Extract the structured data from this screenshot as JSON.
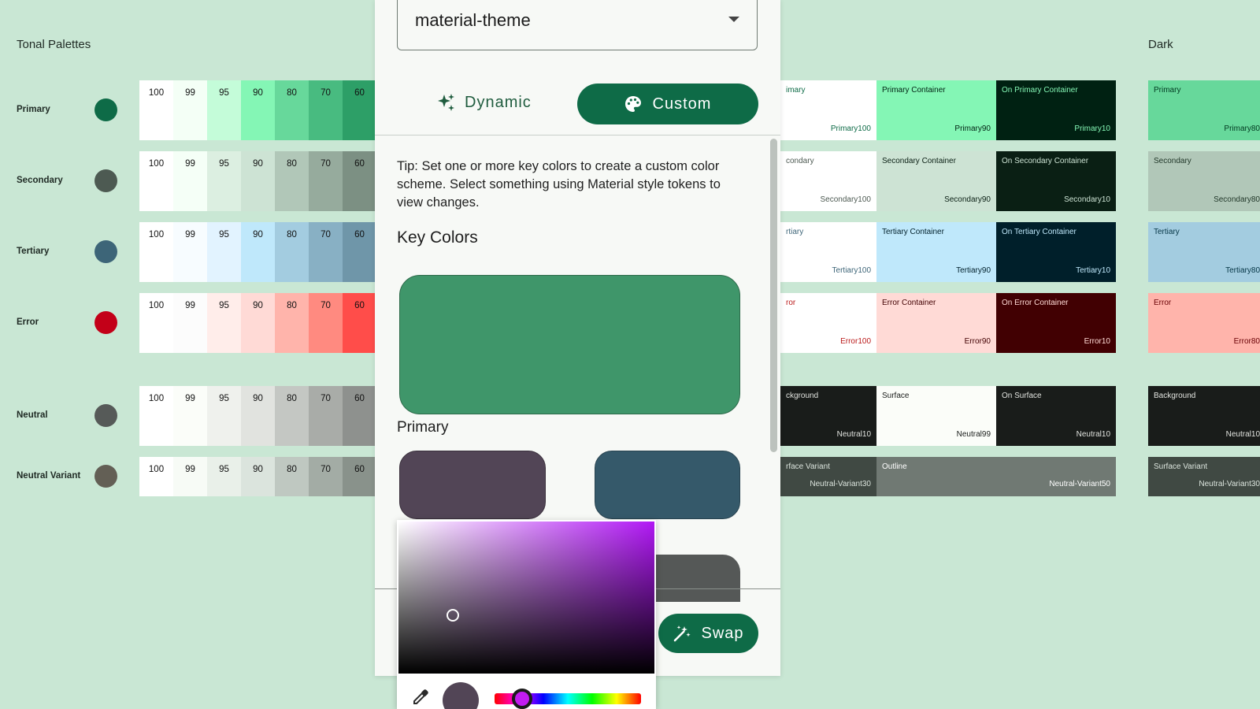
{
  "tonal": {
    "title": "Tonal Palettes",
    "rows": [
      {
        "name": "Primary",
        "dot": "#0e6b47",
        "tones": [
          {
            "label": "100",
            "color": "#ffffff"
          },
          {
            "label": "99",
            "color": "#f4fff6"
          },
          {
            "label": "95",
            "color": "#c4fcd9"
          },
          {
            "label": "90",
            "color": "#84f6b5"
          },
          {
            "label": "80",
            "color": "#67d89b"
          },
          {
            "label": "70",
            "color": "#48bb80"
          },
          {
            "label": "60",
            "color": "#2d9f67"
          }
        ]
      },
      {
        "name": "Secondary",
        "dot": "#4d5a52",
        "tones": [
          {
            "label": "100",
            "color": "#ffffff"
          },
          {
            "label": "99",
            "color": "#f5fff7"
          },
          {
            "label": "95",
            "color": "#dcefe1"
          },
          {
            "label": "90",
            "color": "#cde3d4"
          },
          {
            "label": "80",
            "color": "#b1c7b8"
          },
          {
            "label": "70",
            "color": "#96ab9d"
          },
          {
            "label": "60",
            "color": "#7c9083"
          }
        ]
      },
      {
        "name": "Tertiary",
        "dot": "#3d6578",
        "tones": [
          {
            "label": "100",
            "color": "#ffffff"
          },
          {
            "label": "99",
            "color": "#f7fcff"
          },
          {
            "label": "95",
            "color": "#e2f3ff"
          },
          {
            "label": "90",
            "color": "#bfe8fb"
          },
          {
            "label": "80",
            "color": "#a3cce0"
          },
          {
            "label": "70",
            "color": "#88b0c4"
          },
          {
            "label": "60",
            "color": "#6f96a9"
          }
        ]
      },
      {
        "name": "Error",
        "dot": "#c30018",
        "tones": [
          {
            "label": "100",
            "color": "#ffffff"
          },
          {
            "label": "99",
            "color": "#fcfcfc"
          },
          {
            "label": "95",
            "color": "#ffedea"
          },
          {
            "label": "90",
            "color": "#ffdad6"
          },
          {
            "label": "80",
            "color": "#ffb4ab"
          },
          {
            "label": "70",
            "color": "#ff8a80"
          },
          {
            "label": "60",
            "color": "#ff4d4a"
          }
        ]
      },
      {
        "name": "Neutral",
        "dot": "#565a58",
        "tones": [
          {
            "label": "100",
            "color": "#ffffff"
          },
          {
            "label": "99",
            "color": "#fbfdf9"
          },
          {
            "label": "95",
            "color": "#eff1ed"
          },
          {
            "label": "90",
            "color": "#e1e3df"
          },
          {
            "label": "80",
            "color": "#c4c7c3"
          },
          {
            "label": "70",
            "color": "#a9aca8"
          },
          {
            "label": "60",
            "color": "#8e918e"
          }
        ]
      },
      {
        "name": "Neutral Variant",
        "dot": "#635f55",
        "tones": [
          {
            "label": "100",
            "color": "#ffffff"
          },
          {
            "label": "99",
            "color": "#f7fbf6"
          },
          {
            "label": "95",
            "color": "#e9f0e9"
          },
          {
            "label": "90",
            "color": "#dbe4dd"
          },
          {
            "label": "80",
            "color": "#bfc8c1"
          },
          {
            "label": "70",
            "color": "#a3aca5"
          },
          {
            "label": "60",
            "color": "#89928b"
          }
        ]
      }
    ]
  },
  "scheme": {
    "tiles": [
      {
        "name": "imary",
        "tone": "Primary100",
        "bg": "#ffffff",
        "fg": "#0e6b47"
      },
      {
        "name": "Primary Container",
        "tone": "Primary90",
        "bg": "#84f6b5",
        "fg": "#002112"
      },
      {
        "name": "On Primary Container",
        "tone": "Primary10",
        "bg": "#002112",
        "fg": "#84f6b5"
      },
      {
        "name": "condary",
        "tone": "Secondary100",
        "bg": "#ffffff",
        "fg": "#4d5a52"
      },
      {
        "name": "Secondary Container",
        "tone": "Secondary90",
        "bg": "#cde3d4",
        "fg": "#0a1f14"
      },
      {
        "name": "On Secondary Container",
        "tone": "Secondary10",
        "bg": "#0a1f14",
        "fg": "#cde3d4"
      },
      {
        "name": "rtiary",
        "tone": "Tertiary100",
        "bg": "#ffffff",
        "fg": "#3d6578"
      },
      {
        "name": "Tertiary Container",
        "tone": "Tertiary90",
        "bg": "#bfe8fb",
        "fg": "#001f2a"
      },
      {
        "name": "On Tertiary Container",
        "tone": "Tertiary10",
        "bg": "#001f2a",
        "fg": "#bfe8fb"
      },
      {
        "name": "ror",
        "tone": "Error100",
        "bg": "#ffffff",
        "fg": "#ba1a1a"
      },
      {
        "name": "Error Container",
        "tone": "Error90",
        "bg": "#ffdad6",
        "fg": "#410002"
      },
      {
        "name": "On Error Container",
        "tone": "Error10",
        "bg": "#410002",
        "fg": "#ffdad6"
      },
      {
        "name": "ckground",
        "tone": "Neutral10",
        "bg": "#191c1a",
        "fg": "#e1e3df"
      },
      {
        "name": "Surface",
        "tone": "Neutral99",
        "bg": "#fbfdf9",
        "fg": "#191c1a"
      },
      {
        "name": "On Surface",
        "tone": "Neutral10",
        "bg": "#191c1a",
        "fg": "#e1e3df"
      },
      {
        "name": "rface Variant",
        "tone": "Neutral-Variant30",
        "bg": "#404943",
        "fg": "#dbe4dd"
      },
      {
        "name": "Outline",
        "tone": "Neutral-Variant50",
        "bg": "#707973",
        "fg": "#ffffff"
      }
    ]
  },
  "dark": {
    "title": "Dark",
    "tiles": [
      {
        "name": "Primary",
        "tone": "Primary80",
        "bg": "#67d89b",
        "fg": "#003920"
      },
      {
        "name": "Secondary",
        "tone": "Secondary80",
        "bg": "#b1c7b8",
        "fg": "#1f3527"
      },
      {
        "name": "Tertiary",
        "tone": "Tertiary80",
        "bg": "#a3cce0",
        "fg": "#053545"
      },
      {
        "name": "Error",
        "tone": "Error80",
        "bg": "#ffb4ab",
        "fg": "#690005"
      },
      {
        "name": "Background",
        "tone": "Neutral10",
        "bg": "#191c1a",
        "fg": "#e1e3df"
      },
      {
        "name": "Surface Variant",
        "tone": "Neutral-Variant30",
        "bg": "#404943",
        "fg": "#dbe4dd"
      }
    ]
  },
  "panel": {
    "theme_value": "material-theme",
    "dynamic_label": "Dynamic",
    "custom_label": "Custom",
    "tip": "Tip: Set one or more key colors to create a custom color scheme. Select something using Material style tokens to view changes.",
    "key_colors_title": "Key Colors",
    "primary_label": "Primary",
    "swap_label": "Swap",
    "colors": {
      "primary": "#3f966a",
      "secondary": "#524556",
      "tertiary": "#35596a",
      "accent": "#0e6b47"
    }
  },
  "picker": {
    "current_color": "#524556"
  }
}
